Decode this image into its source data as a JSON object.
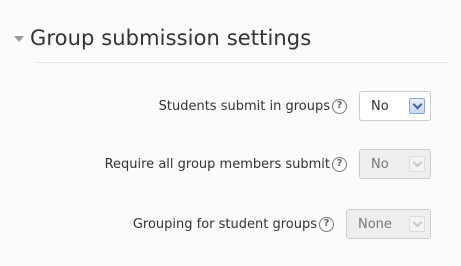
{
  "section": {
    "title": "Group submission settings",
    "collapse_icon": "triangle-down"
  },
  "fields": [
    {
      "label": "Students submit in groups",
      "help_icon": "question-circle",
      "value": "No",
      "enabled": true
    },
    {
      "label": "Require all group members submit",
      "help_icon": "question-circle",
      "value": "No",
      "enabled": false
    },
    {
      "label": "Grouping for student groups",
      "help_icon": "question-circle",
      "value": "None",
      "enabled": false
    }
  ],
  "colors": {
    "active_chevron": "#3a5fa8",
    "disabled_field_bg": "#eeeeee"
  }
}
